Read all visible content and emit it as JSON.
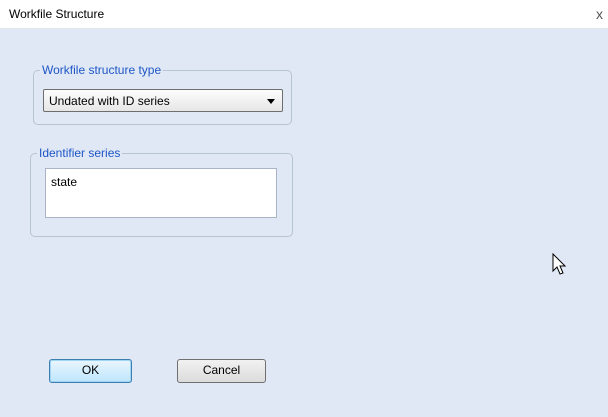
{
  "window": {
    "title": "Workfile Structure",
    "close_glyph": "x"
  },
  "structure_group": {
    "legend": "Workfile structure type",
    "selected": "Undated with ID series"
  },
  "identifier_group": {
    "legend": "Identifier series",
    "items": [
      "state"
    ]
  },
  "buttons": {
    "ok": "OK",
    "cancel": "Cancel"
  },
  "icons": {
    "cursor": "mouse-pointer-icon"
  },
  "colors": {
    "legend_text": "#1e56c8",
    "background": "#dfe8f4"
  }
}
